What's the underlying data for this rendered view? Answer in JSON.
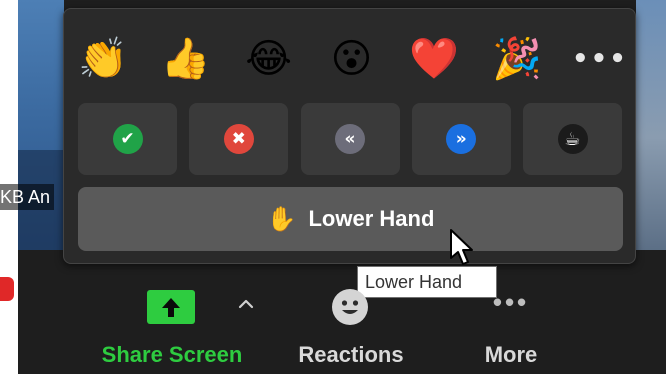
{
  "video": {
    "name_tag": "KB An"
  },
  "reactions_popup": {
    "emojis": [
      {
        "name": "clapping-hands",
        "glyph": "👏"
      },
      {
        "name": "thumbs-up",
        "glyph": "👍"
      },
      {
        "name": "tears-of-joy",
        "glyph": "😂"
      },
      {
        "name": "open-mouth",
        "glyph": "😮"
      },
      {
        "name": "red-heart",
        "glyph": "❤️"
      },
      {
        "name": "party-popper",
        "glyph": "🎉"
      }
    ],
    "more_emojis": "•••",
    "status_buttons": [
      {
        "name": "yes",
        "icon": "check-icon",
        "glyph": "✔",
        "color": "#20a348"
      },
      {
        "name": "no",
        "icon": "close-icon",
        "glyph": "✖",
        "color": "#e0473c"
      },
      {
        "name": "slow-down",
        "icon": "rewind-icon",
        "glyph": "«",
        "color": "#6d6d7a"
      },
      {
        "name": "speed-up",
        "icon": "fast-forward-icon",
        "glyph": "»",
        "color": "#1a6fe0"
      },
      {
        "name": "coffee",
        "icon": "coffee-cup-icon",
        "glyph": "☕",
        "color": "#1b1b1b"
      }
    ],
    "lower_hand": {
      "glyph": "✋",
      "label": "Lower Hand"
    }
  },
  "tooltip": {
    "text": "Lower Hand"
  },
  "toolbar": {
    "share_screen": {
      "label": "Share Screen",
      "color": "#2ecc40"
    },
    "reactions": {
      "label": "Reactions"
    },
    "more": {
      "label": "More",
      "icon_glyph": "•••"
    }
  }
}
